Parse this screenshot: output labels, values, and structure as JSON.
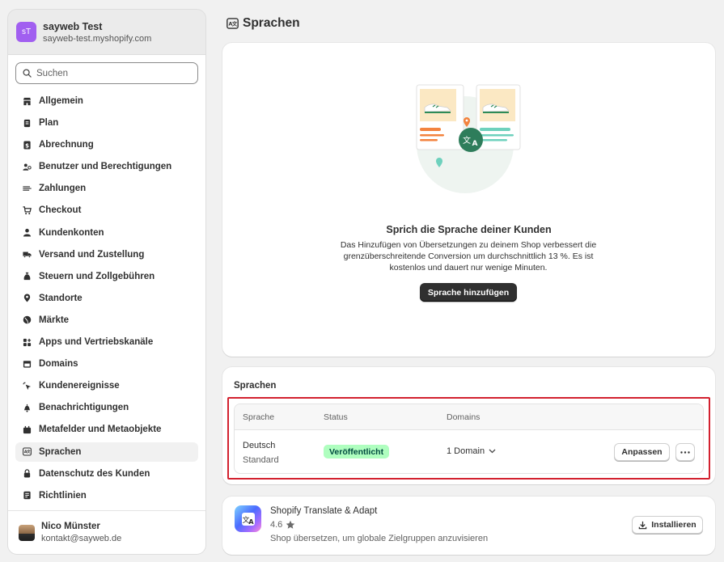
{
  "store": {
    "initials": "sT",
    "name": "sayweb Test",
    "domain": "sayweb-test.myshopify.com"
  },
  "search": {
    "placeholder": "Suchen"
  },
  "nav": [
    {
      "label": "Allgemein",
      "icon": "store-icon"
    },
    {
      "label": "Plan",
      "icon": "plan-icon"
    },
    {
      "label": "Abrechnung",
      "icon": "dollar-icon"
    },
    {
      "label": "Benutzer und Berechtigungen",
      "icon": "users-icon"
    },
    {
      "label": "Zahlungen",
      "icon": "payments-icon"
    },
    {
      "label": "Checkout",
      "icon": "cart-icon"
    },
    {
      "label": "Kundenkonten",
      "icon": "person-icon"
    },
    {
      "label": "Versand und Zustellung",
      "icon": "truck-icon"
    },
    {
      "label": "Steuern und Zollgebühren",
      "icon": "tax-icon"
    },
    {
      "label": "Standorte",
      "icon": "location-icon"
    },
    {
      "label": "Märkte",
      "icon": "globe-icon"
    },
    {
      "label": "Apps und Vertriebskanäle",
      "icon": "apps-icon"
    },
    {
      "label": "Domains",
      "icon": "domain-icon"
    },
    {
      "label": "Kundenereignisse",
      "icon": "cursor-icon"
    },
    {
      "label": "Benachrichtigungen",
      "icon": "bell-icon"
    },
    {
      "label": "Metafelder und Metaobjekte",
      "icon": "metafields-icon"
    },
    {
      "label": "Sprachen",
      "icon": "language-icon",
      "active": true
    },
    {
      "label": "Datenschutz des Kunden",
      "icon": "lock-icon"
    },
    {
      "label": "Richtlinien",
      "icon": "policy-icon"
    }
  ],
  "user": {
    "name": "Nico Münster",
    "email": "kontakt@sayweb.de"
  },
  "page": {
    "title": "Sprachen"
  },
  "hero": {
    "title": "Sprich die Sprache deiner Kunden",
    "description": "Das Hinzufügen von Übersetzungen zu deinem Shop verbessert die grenzüberschreitende Conversion um durchschnittlich 13 %. Es ist kostenlos und dauert nur wenige Minuten.",
    "button": "Sprache hinzufügen"
  },
  "languages": {
    "title": "Sprachen",
    "columns": {
      "language": "Sprache",
      "status": "Status",
      "domains": "Domains"
    },
    "rows": [
      {
        "language": "Deutsch",
        "sub": "Standard",
        "status": "Veröffentlicht",
        "domains": "1 Domain",
        "action": "Anpassen"
      }
    ]
  },
  "app": {
    "name": "Shopify Translate & Adapt",
    "rating": "4.6",
    "description": "Shop übersetzen, um globale Zielgruppen anzuvisieren",
    "button": "Installieren"
  },
  "colors": {
    "accent": "#303030",
    "badge_bg": "#affebf",
    "badge_text": "#014b40",
    "highlight": "#d3212f",
    "store_avatar": "#a15ff0"
  }
}
